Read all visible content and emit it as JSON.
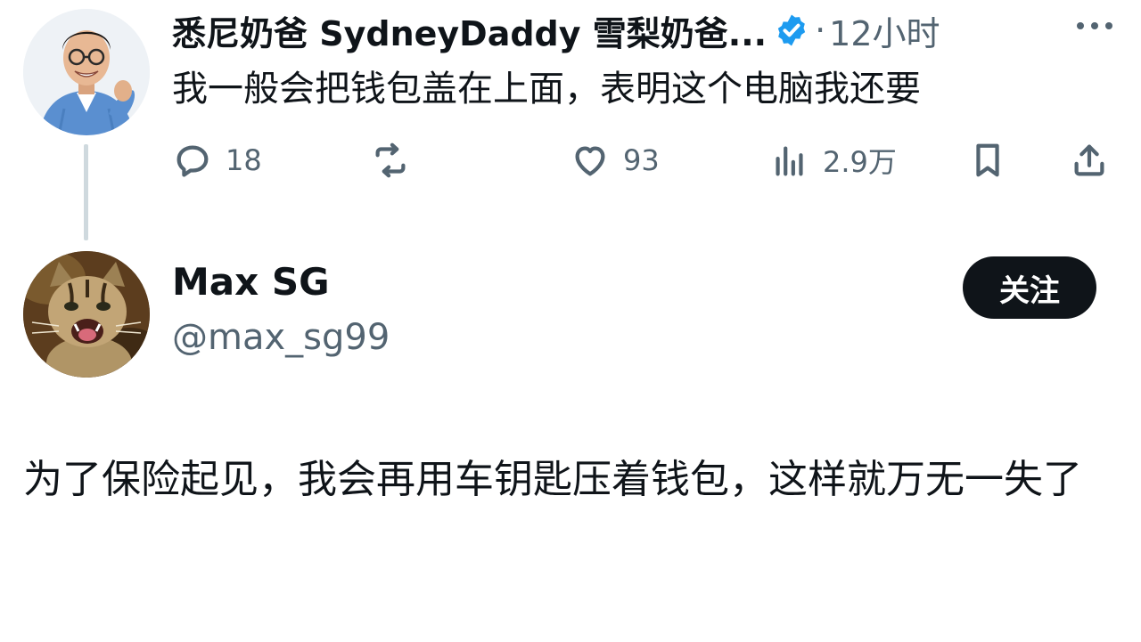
{
  "parent_tweet": {
    "author_name": "悉尼奶爸 SydneyDaddy 雪梨奶爸...",
    "separator": "·",
    "time": "12小时",
    "text": "我一般会把钱包盖在上面，表明这个电脑我还要",
    "avatar_icon": "person-avatar",
    "verified_icon": "verified-badge-icon",
    "actions": {
      "reply_count": "18",
      "retweet_count": "",
      "like_count": "93",
      "views_count": "2.9万"
    }
  },
  "reply": {
    "author_name": "Max SG",
    "handle": "@max_sg99",
    "follow_label": "关注",
    "avatar_icon": "cat-avatar",
    "text": "为了保险起见，我会再用车钥匙压着钱包，这样就万无一失了"
  },
  "colors": {
    "text_primary": "#0f1419",
    "text_secondary": "#536471",
    "verified_blue": "#1d9bf0",
    "thread_line": "#cfd9de",
    "follow_bg": "#0f1419"
  }
}
